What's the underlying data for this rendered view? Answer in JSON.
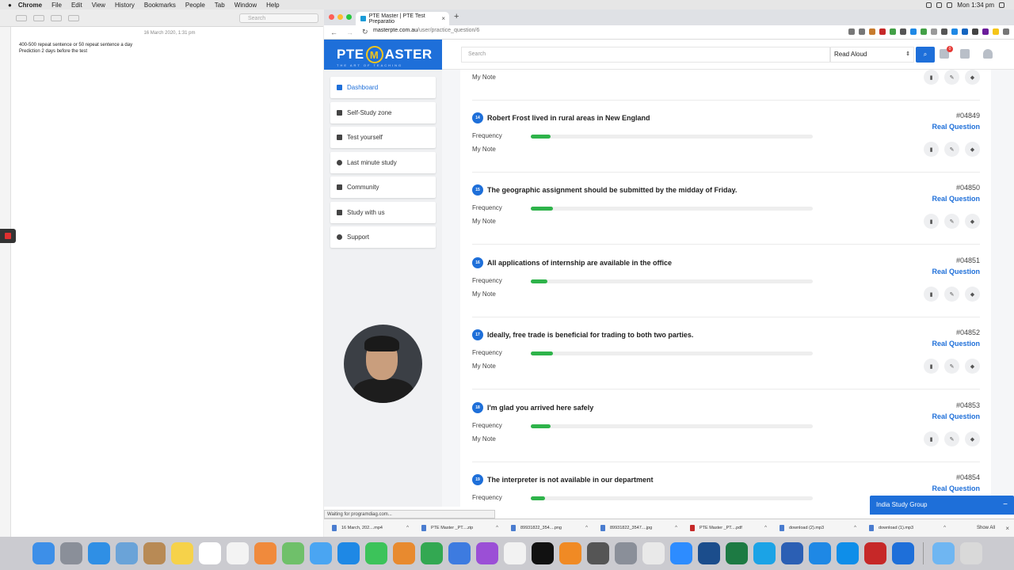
{
  "menubar": {
    "items": [
      "Chrome",
      "File",
      "Edit",
      "View",
      "History",
      "Bookmarks",
      "People",
      "Tab",
      "Window",
      "Help"
    ],
    "clock": "Mon 1:34 pm"
  },
  "notes": {
    "search_placeholder": "Search",
    "date": "16 March 2020, 1:31 pm",
    "lines": [
      "400-500 repeat sentence or 50 repeat sentence a day",
      "Prediction 2 days before the test"
    ]
  },
  "browser": {
    "tab_title": "PTE Master | PTE Test Preparatio",
    "url_host": "masterpte.com.au",
    "url_path": "/user/practice_question/6",
    "status": "Waiting for programdiag.com..."
  },
  "site": {
    "logo_text_left": "PTE",
    "logo_text_right": "ASTER",
    "logo_m": "M",
    "logo_tagline": "THE ART OF TEACHING",
    "search_placeholder": "Search",
    "select_value": "Read Aloud",
    "cart_count": "0",
    "menu": [
      {
        "label": "Dashboard",
        "active": true
      },
      {
        "label": "Self-Study zone",
        "active": false
      },
      {
        "label": "Test yourself",
        "active": false
      },
      {
        "label": "Last minute study",
        "active": false
      },
      {
        "label": "Community",
        "active": false
      },
      {
        "label": "Study with us",
        "active": false
      },
      {
        "label": "Support",
        "active": false
      }
    ],
    "frequency_label": "Frequency",
    "note_label": "My Note",
    "real_label": "Real Question",
    "questions": [
      {
        "num": "14",
        "title": "Robert Frost lived in rural areas in New England",
        "id": "#04849",
        "freq": 0.07
      },
      {
        "num": "15",
        "title": "The geographic assignment should be submitted by the midday of Friday.",
        "id": "#04850",
        "freq": 0.08
      },
      {
        "num": "16",
        "title": "All applications of internship are available in the office",
        "id": "#04851",
        "freq": 0.06
      },
      {
        "num": "17",
        "title": "Ideally, free trade is beneficial for trading to both two parties.",
        "id": "#04852",
        "freq": 0.08
      },
      {
        "num": "18",
        "title": "I'm glad you arrived here safely",
        "id": "#04853",
        "freq": 0.07
      },
      {
        "num": "19",
        "title": "The interpreter is not available in our department",
        "id": "#04854",
        "freq": 0.05
      }
    ],
    "chat_label": "India Study Group"
  },
  "downloads": {
    "items": [
      "16 March, 202....mp4",
      "PTE Master _PT....zip",
      "89931822_354....png",
      "89931822_3547....jpg",
      "PTE Master _PT....pdf",
      "download (2).mp3",
      "download (1).mp3"
    ],
    "show_all": "Show All"
  },
  "colors": {
    "brand": "#1e6fd9",
    "bar": "#2eb34a"
  }
}
